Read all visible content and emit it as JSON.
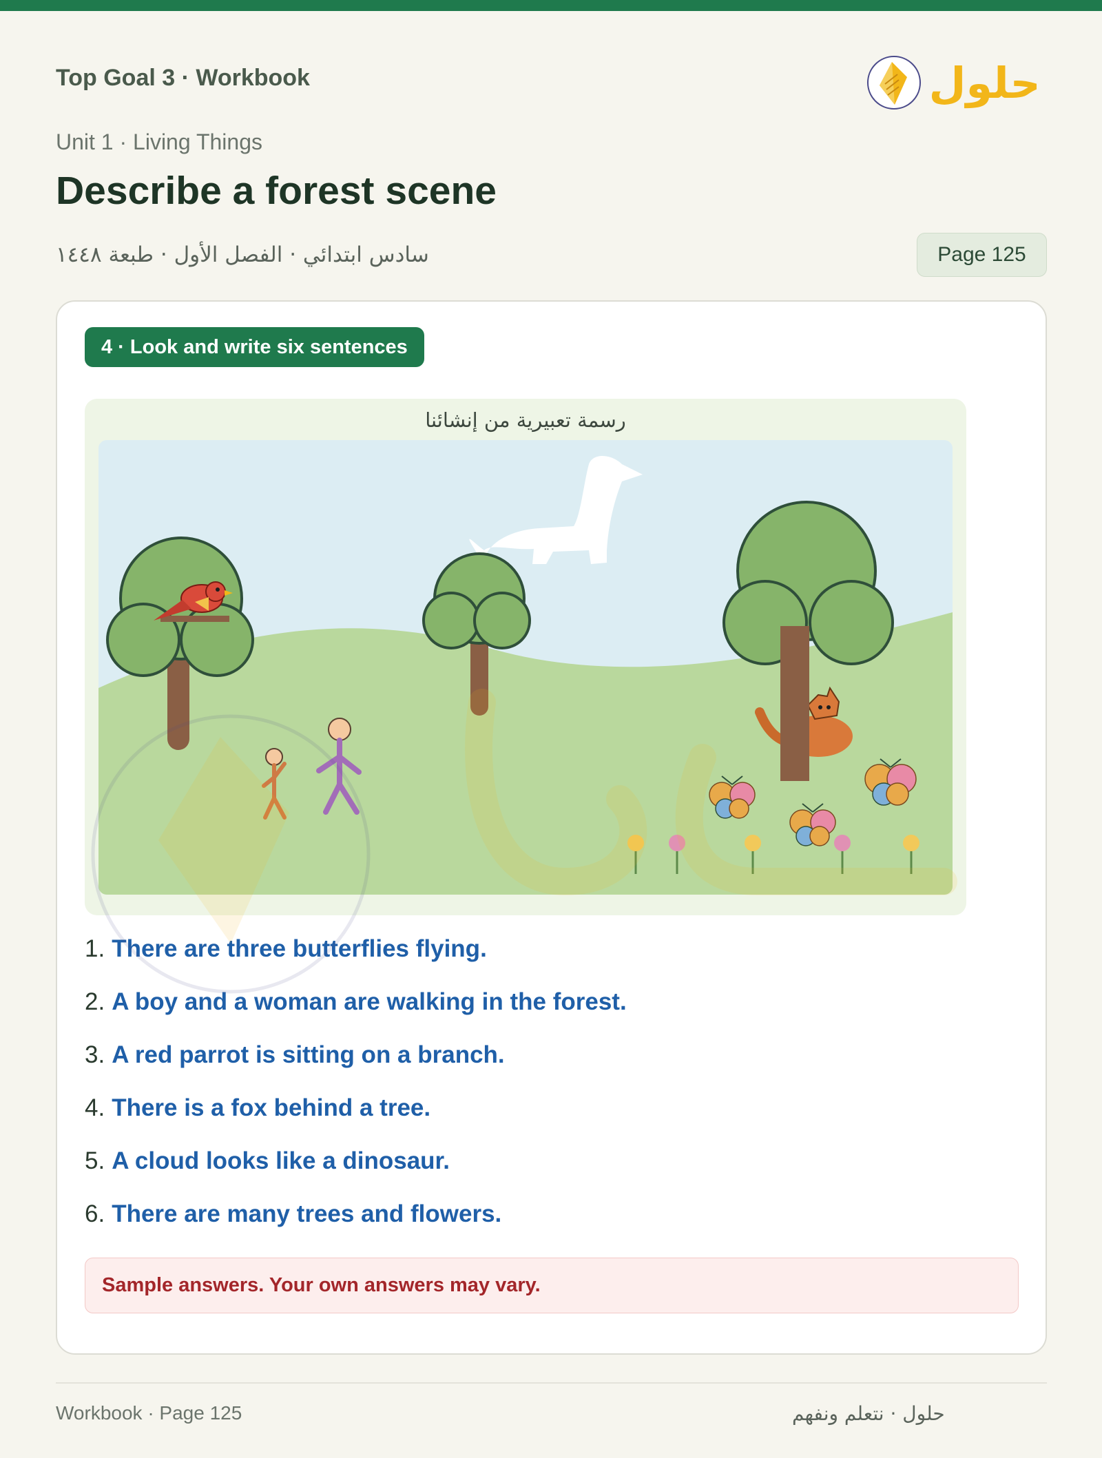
{
  "header": {
    "title": "Top Goal 3 · Workbook",
    "unit": "Unit 1 · Living Things",
    "page_title": "Describe a forest scene",
    "arabic_subtitle": "سادس ابتدائي · الفصل الأول · طبعة ١٤٤٨",
    "page_badge": "Page 125",
    "logo_text": "حلول"
  },
  "exercise": {
    "label": "4 · Look and write six sentences",
    "figure_caption": "رسمة تعبيرية من إنشائنا",
    "answers": [
      {
        "num": "1.",
        "text": "There are three butterflies flying."
      },
      {
        "num": "2.",
        "text": "A boy and a woman are walking in the forest."
      },
      {
        "num": "3.",
        "text": "A red parrot is sitting on a branch."
      },
      {
        "num": "4.",
        "text": "There is a fox behind a tree."
      },
      {
        "num": "5.",
        "text": "A cloud looks like a dinosaur."
      },
      {
        "num": "6.",
        "text": "There are many trees and flowers."
      }
    ],
    "note": "Sample answers. Your own answers may vary."
  },
  "footer": {
    "left": "Workbook · Page 125",
    "right": "حلول · نتعلم ونفهم"
  },
  "colors": {
    "accent": "#1f7a4d",
    "answer_text": "#1f5fa8",
    "note_text": "#a3262a",
    "note_bg": "#fdeeed",
    "logo_yellow": "#f2b619"
  }
}
